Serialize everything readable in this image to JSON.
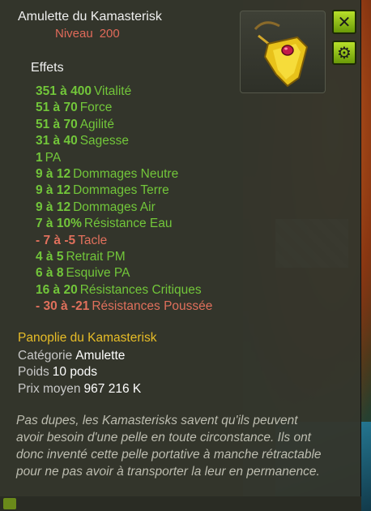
{
  "item": {
    "name": "Amulette du Kamasterisk",
    "level_label": "Niveau",
    "level_value": "200"
  },
  "buttons": {
    "close": "close-icon",
    "settings": "gear-icon"
  },
  "effects_header": "Effets",
  "effects": [
    {
      "value": "351 à 400",
      "name": "Vitalité",
      "tone": "pos"
    },
    {
      "value": "51 à 70",
      "name": "Force",
      "tone": "pos"
    },
    {
      "value": "51 à 70",
      "name": "Agilité",
      "tone": "pos"
    },
    {
      "value": "31 à 40",
      "name": "Sagesse",
      "tone": "pos"
    },
    {
      "value": "1",
      "name": "PA",
      "tone": "pos"
    },
    {
      "value": "9 à 12",
      "name": "Dommages Neutre",
      "tone": "pos"
    },
    {
      "value": "9 à 12",
      "name": "Dommages Terre",
      "tone": "pos"
    },
    {
      "value": "9 à 12",
      "name": "Dommages Air",
      "tone": "pos"
    },
    {
      "value": "7 à 10%",
      "name": "Résistance Eau",
      "tone": "pos"
    },
    {
      "value": "- 7 à -5",
      "name": "Tacle",
      "tone": "neg"
    },
    {
      "value": "4 à 5",
      "name": "Retrait PM",
      "tone": "pos"
    },
    {
      "value": "6 à 8",
      "name": "Esquive PA",
      "tone": "pos"
    },
    {
      "value": "16 à 20",
      "name": "Résistances Critiques",
      "tone": "pos"
    },
    {
      "value": "- 30 à -21",
      "name": "Résistances Poussée",
      "tone": "neg"
    }
  ],
  "set_name": "Panoplie du Kamasterisk",
  "details": {
    "category_label": "Catégorie",
    "category_value": "Amulette",
    "weight_label": "Poids",
    "weight_value": "10 pods",
    "price_label": "Prix moyen",
    "price_value": "967 216 K"
  },
  "description": "Pas dupes, les Kamasterisks savent qu'ils peuvent avoir besoin d'une pelle en toute circonstance. Ils ont donc inventé cette pelle portative à manche rétractable pour ne pas avoir à transporter la leur en permanence.",
  "colors": {
    "positive": "#72c63a",
    "negative": "#e0705c",
    "set": "#e8bd27",
    "level": "#e06a5a",
    "button": "#9fd11c"
  }
}
